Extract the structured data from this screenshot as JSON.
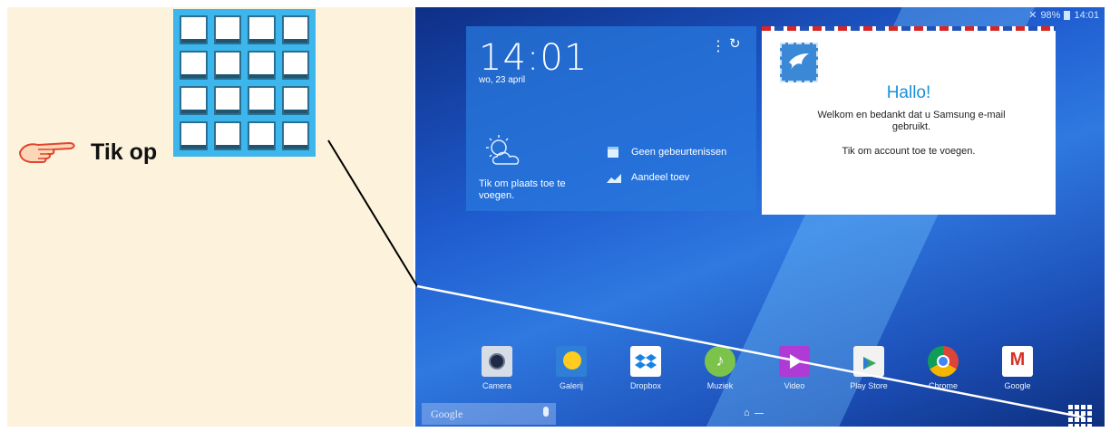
{
  "instruction": {
    "text": "Tik op",
    "hand_icon": "pointing-hand-icon",
    "apps_icon": "apps-grid-icon"
  },
  "status_bar": {
    "battery": "98%",
    "time": "14:01"
  },
  "clock_widget": {
    "time": "14:01",
    "date": "wo, 23 april",
    "weather_prompt": "Tik om plaats toe te voegen.",
    "calendar_text": "Geen gebeurtenissen",
    "stock_text": "Aandeel toev"
  },
  "email_widget": {
    "title": "Hallo!",
    "welcome": "Welkom en bedankt dat u Samsung e-mail gebruikt.",
    "add_account": "Tik om account toe te voegen."
  },
  "dock": {
    "apps": [
      {
        "label": "Camera",
        "icon": "camera-icon"
      },
      {
        "label": "Galerij",
        "icon": "gallery-icon"
      },
      {
        "label": "Dropbox",
        "icon": "dropbox-icon"
      },
      {
        "label": "Muziek",
        "icon": "music-icon"
      },
      {
        "label": "Video",
        "icon": "video-icon"
      },
      {
        "label": "Play Store",
        "icon": "play-store-icon"
      },
      {
        "label": "Chrome",
        "icon": "chrome-icon"
      },
      {
        "label": "Google",
        "icon": "google-icon"
      }
    ]
  },
  "search": {
    "placeholder": "Google"
  },
  "colors": {
    "panel_bg": "#fdf3dc",
    "grid_icon_bg": "#3cb6ec",
    "hello_blue": "#1a90d8"
  }
}
